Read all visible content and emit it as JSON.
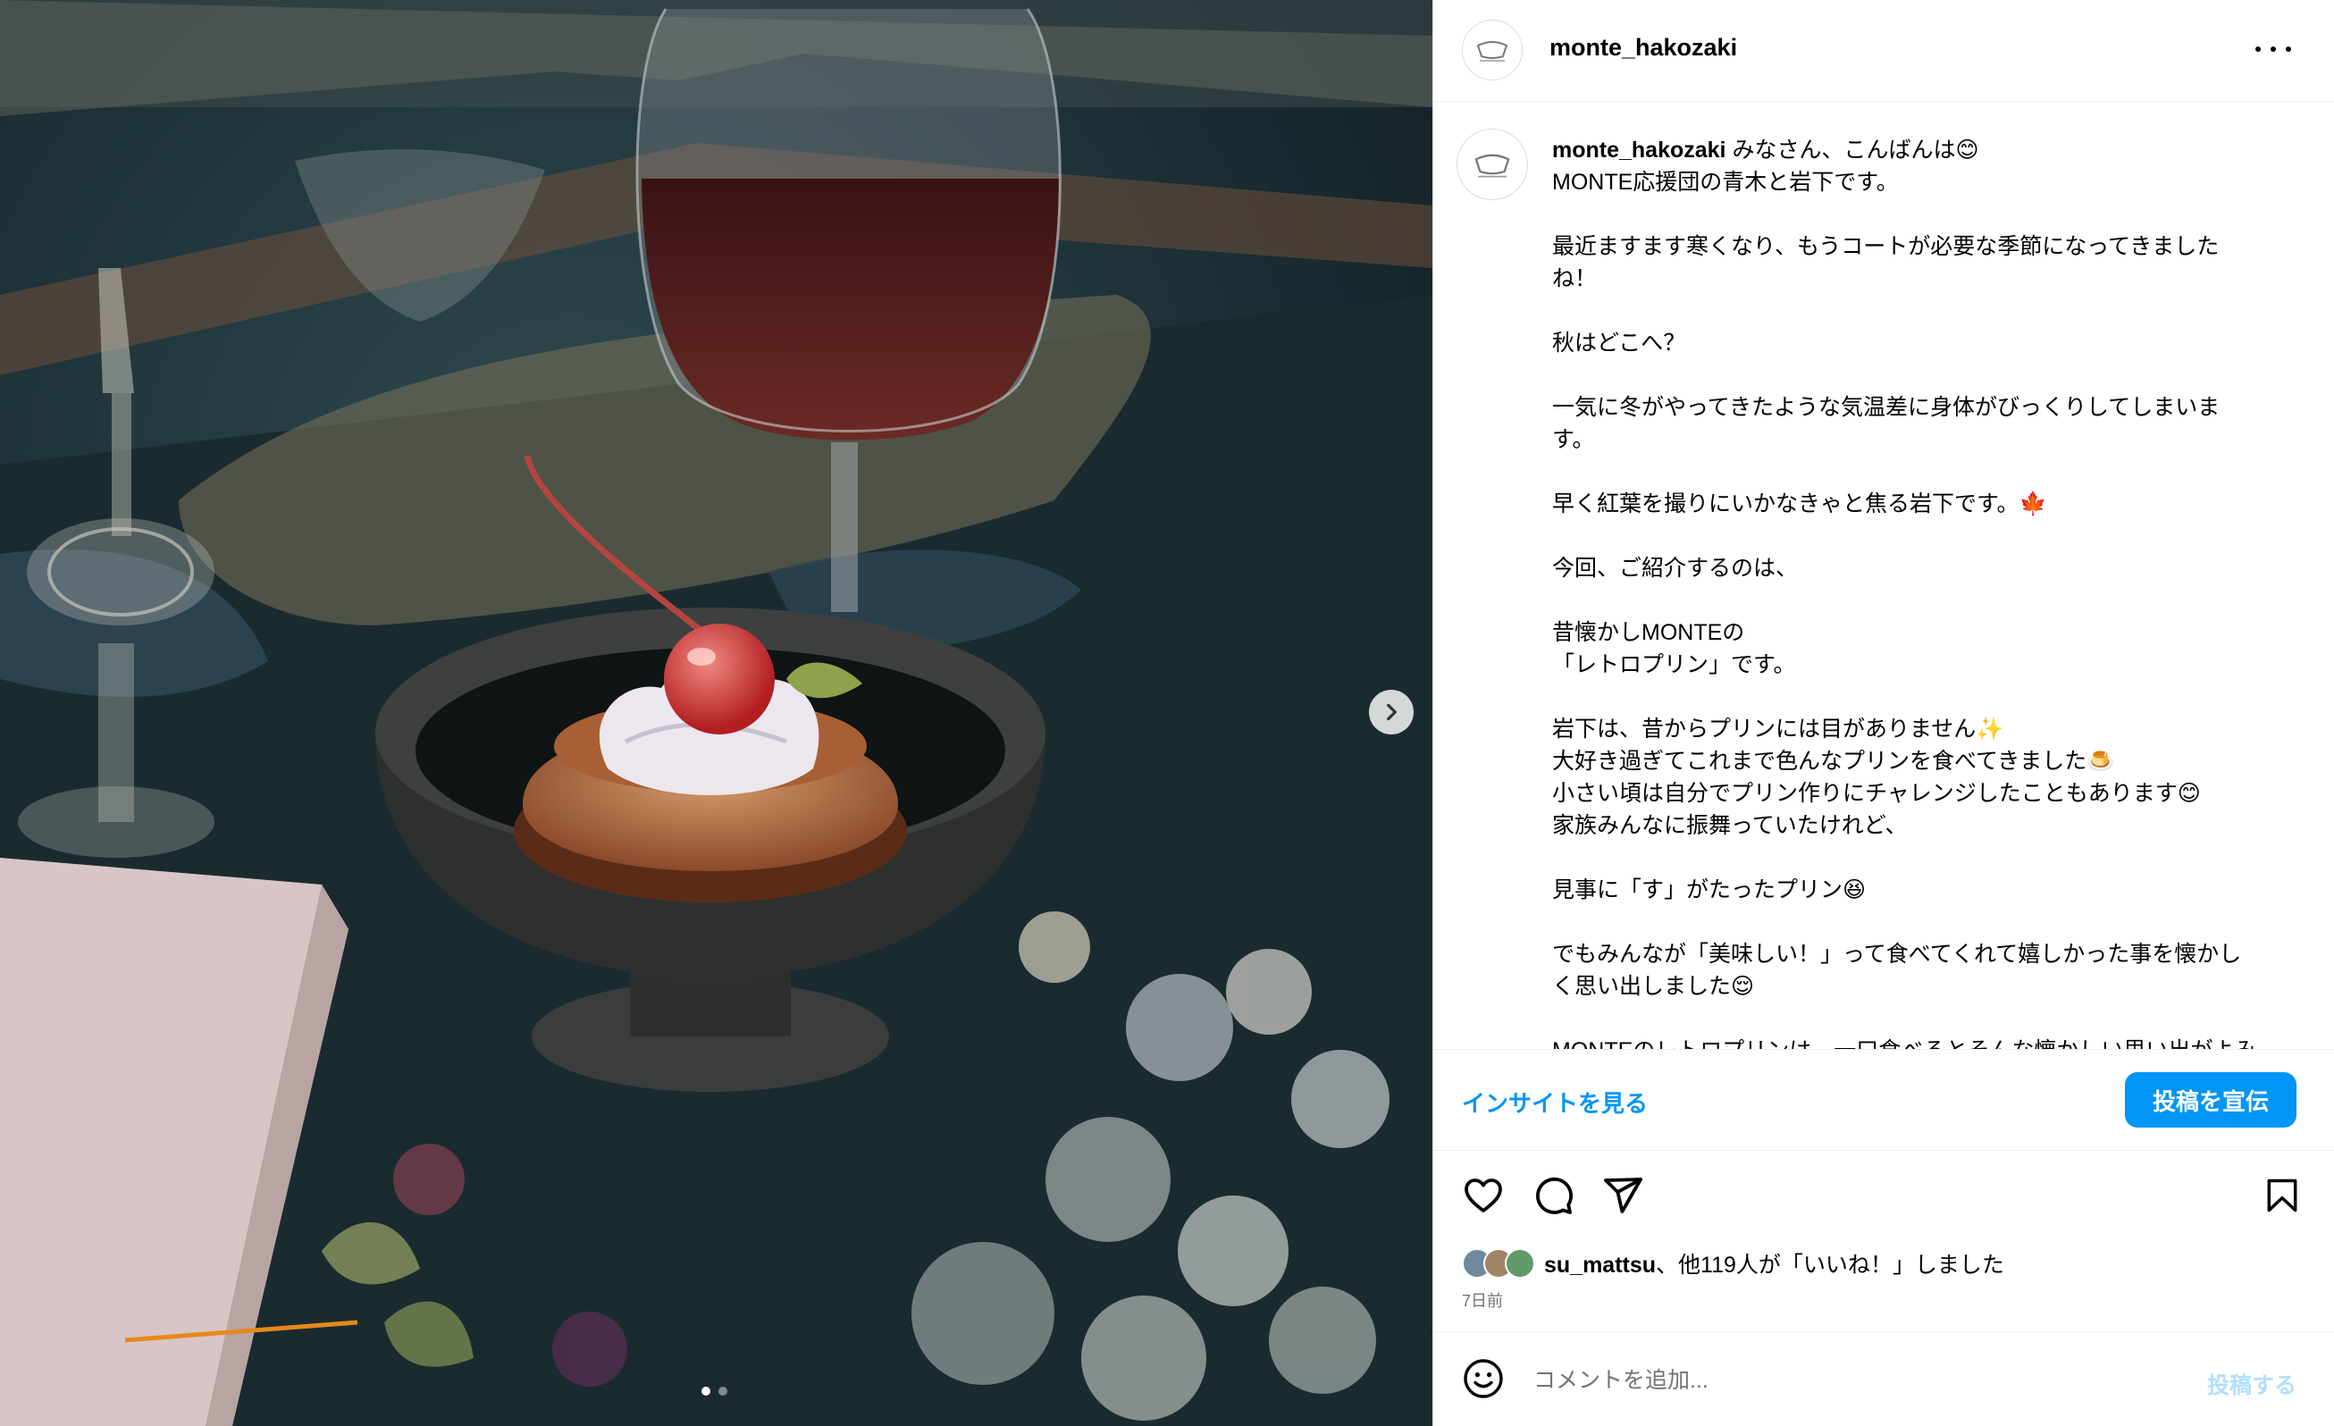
{
  "post": {
    "username": "monte_hakozaki",
    "caption_user": "monte_hakozaki",
    "caption_text": " みなさん、こんばんは😊\nMONTE応援団の青木と岩下です。\n\n最近ますます寒くなり、もうコートが必要な季節になってきました\nね！\n\n秋はどこへ？\n\n一気に冬がやってきたような気温差に身体がびっくりしてしまいま\nす。\n\n早く紅葉を撮りにいかなきゃと焦る岩下です。🍁\n\n今回、ご紹介するのは、\n\n昔懐かしMONTEの\n「レトロプリン」です。\n\n岩下は、昔からプリンには目がありません✨\n大好き過ぎてこれまで色んなプリンを食べてきました🍮\n小さい頃は自分でプリン作りにチャレンジしたこともあります😊\n家族みんなに振舞っていたけれど、\n\n見事に「す」がたったプリン😆\n\nでもみんなが「美味しい！」って食べてくれて嬉しかった事を懐かし\nく思い出しました😌\n\nMONTEのレトロプリンは、一口食べるとそんな懐かしい思い出がよみ",
    "insights_label": "インサイトを見る",
    "promote_label": "投稿を宣伝",
    "likes_user": "su_mattsu",
    "likes_rest": "、他119人が「いいね！」しました",
    "time_ago": "7日前",
    "comment_placeholder": "コメントを追加...",
    "post_button": "投稿する"
  },
  "carousel": {
    "current": 1,
    "total": 2
  },
  "icons": {
    "more": "more-horizontal-icon",
    "like": "heart-icon",
    "comment": "comment-bubble-icon",
    "share": "paper-plane-icon",
    "save": "bookmark-icon",
    "emoji": "smiley-icon",
    "next": "chevron-right-icon"
  },
  "colors": {
    "link": "#0095f6",
    "button": "#0095f6",
    "post_disabled": "#b2dffc",
    "muted": "#737373"
  }
}
